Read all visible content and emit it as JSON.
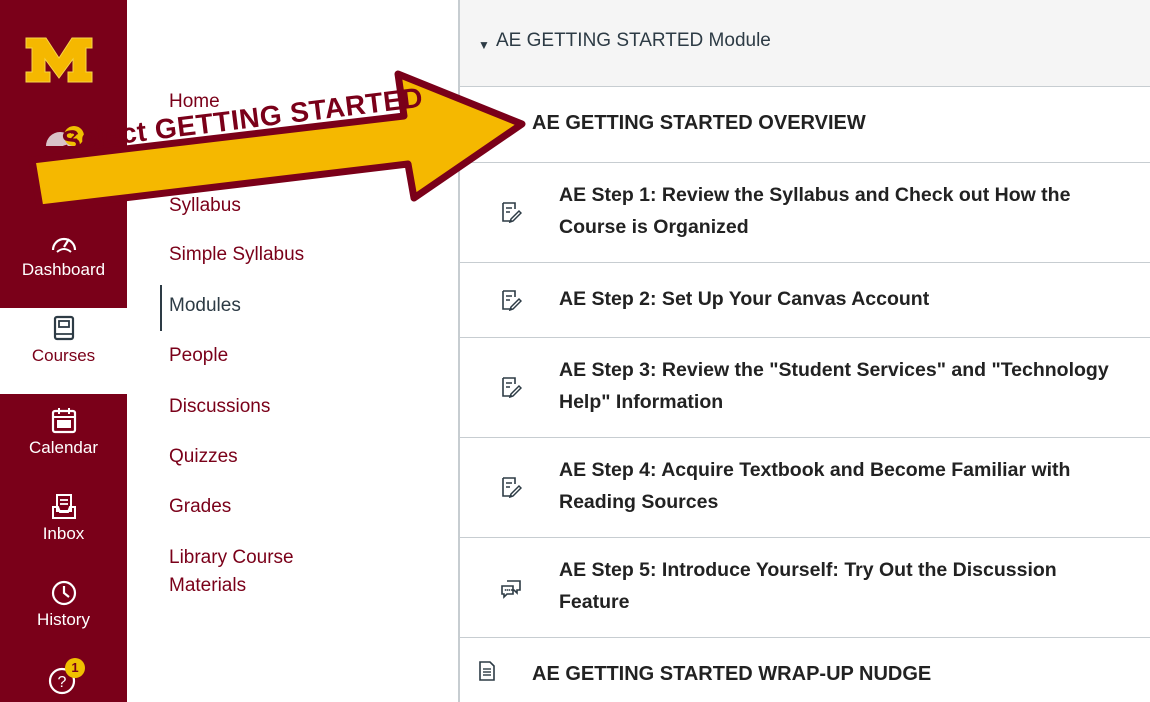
{
  "global_nav": {
    "logo_icon": "university-m-logo-icon",
    "account_badge": "2",
    "help_badge": "1",
    "items": [
      {
        "label": "Dashboard",
        "icon": "dashboard-gauge-icon"
      },
      {
        "label": "Courses",
        "icon": "book-icon"
      },
      {
        "label": "Calendar",
        "icon": "calendar-icon"
      },
      {
        "label": "Inbox",
        "icon": "inbox-icon"
      },
      {
        "label": "History",
        "icon": "clock-icon"
      }
    ]
  },
  "course_nav": {
    "items": [
      {
        "label": "Home"
      },
      {
        "label": "Syllabus"
      },
      {
        "label": "Simple Syllabus"
      },
      {
        "label": "Modules",
        "active": true
      },
      {
        "label": "People"
      },
      {
        "label": "Discussions"
      },
      {
        "label": "Quizzes"
      },
      {
        "label": "Grades"
      },
      {
        "label": "Library Course Materials"
      }
    ]
  },
  "module": {
    "title": "AE GETTING STARTED Module",
    "overview": "AE GETTING STARTED OVERVIEW",
    "items": [
      {
        "title": "AE Step 1: Review the Syllabus and Check out How the Course is Organized",
        "icon": "assignment-icon"
      },
      {
        "title": "AE Step 2: Set Up Your Canvas Account",
        "icon": "assignment-icon"
      },
      {
        "title": "AE Step 3: Review the \"Student Services\" and \"Technology Help\" Information",
        "icon": "assignment-icon"
      },
      {
        "title": "AE Step 4: Acquire Textbook and Become Familiar with Reading Sources",
        "icon": "assignment-icon"
      },
      {
        "title": "AE Step 5: Introduce Yourself: Try Out the Discussion Feature",
        "icon": "discussion-icon"
      }
    ],
    "wrapup": "AE GETTING STARTED WRAP-UP NUDGE"
  },
  "callout": {
    "text": "Select GETTING STARTED",
    "colors": {
      "fill": "#f5b800",
      "border": "#7a0019"
    }
  },
  "colors": {
    "brand": "#7a0019",
    "text": "#2d3b45",
    "badge": "#f0c000"
  }
}
